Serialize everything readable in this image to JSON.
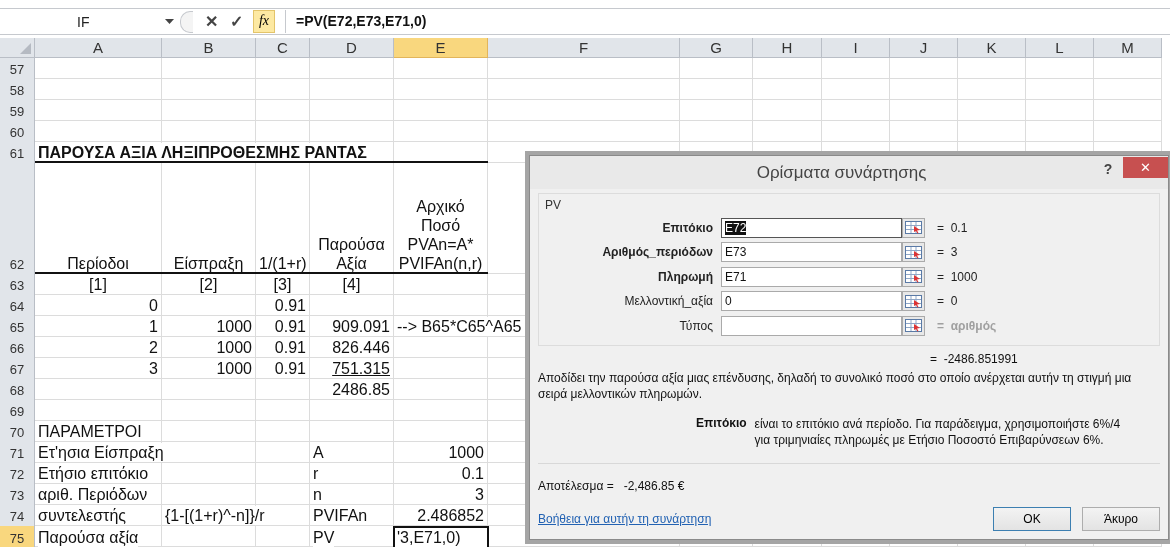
{
  "formula_bar": {
    "name_box": "IF",
    "cancel": "✕",
    "enter": "✓",
    "fx": "fx",
    "formula": "=PV(E72,E73,E71,0)"
  },
  "columns": [
    {
      "label": "A",
      "selected": false
    },
    {
      "label": "B",
      "selected": false
    },
    {
      "label": "C",
      "selected": false
    },
    {
      "label": "D",
      "selected": false
    },
    {
      "label": "E",
      "selected": true
    },
    {
      "label": "F",
      "selected": false
    },
    {
      "label": "G",
      "selected": false
    },
    {
      "label": "H",
      "selected": false
    },
    {
      "label": "I",
      "selected": false
    },
    {
      "label": "J",
      "selected": false
    },
    {
      "label": "K",
      "selected": false
    },
    {
      "label": "L",
      "selected": false
    },
    {
      "label": "M",
      "selected": false
    }
  ],
  "rows": [
    {
      "number": "57",
      "selected": false,
      "rule_below": false,
      "cells": []
    },
    {
      "number": "58",
      "selected": false,
      "rule_below": false,
      "cells": []
    },
    {
      "number": "59",
      "selected": false,
      "rule_below": false,
      "cells": []
    },
    {
      "number": "60",
      "selected": false,
      "rule_below": false,
      "cells": []
    },
    {
      "number": "61",
      "selected": false,
      "rule_below": true,
      "cells": [
        {
          "kind": "text",
          "text": "ΠΑΡΟΥΣΑ ΑΞΙΑ ΛΗΞΙΠΡΟΘΕΣΜΗΣ ΡΑΝΤΑΣ",
          "bold": true
        }
      ]
    },
    {
      "number": "62",
      "selected": false,
      "rule_below": true,
      "cells": [
        {
          "kind": "heading",
          "text": "Περίοδοι"
        },
        {
          "kind": "heading",
          "text": "Είσπραξη"
        },
        {
          "kind": "heading",
          "text": "1/(1+r)"
        },
        {
          "kind": "heading",
          "text": "Παρούσα\nΑξία"
        },
        {
          "kind": "heading",
          "text": "Αρχικό\nΠοσό\nPVAn=A*\nPVIFAn(n,r)"
        }
      ]
    },
    {
      "number": "63",
      "selected": false,
      "rule_below": false,
      "cells": [
        {
          "kind": "heading",
          "text": "[1]"
        },
        {
          "kind": "heading",
          "text": "[2]"
        },
        {
          "kind": "heading",
          "text": "[3]"
        },
        {
          "kind": "heading",
          "text": "[4]"
        }
      ]
    },
    {
      "number": "64",
      "selected": false,
      "rule_below": false,
      "cells": [
        {
          "kind": "number",
          "text": "0"
        },
        {
          "kind": "empty"
        },
        {
          "kind": "number",
          "text": "0.91"
        }
      ]
    },
    {
      "number": "65",
      "selected": false,
      "rule_below": false,
      "cells": [
        {
          "kind": "number",
          "text": "1"
        },
        {
          "kind": "number",
          "text": "1000"
        },
        {
          "kind": "number",
          "text": "0.91"
        },
        {
          "kind": "number",
          "text": "909.091"
        },
        {
          "kind": "text",
          "text": "--> B65*C65^A65"
        }
      ]
    },
    {
      "number": "66",
      "selected": false,
      "rule_below": false,
      "cells": [
        {
          "kind": "number",
          "text": "2"
        },
        {
          "kind": "number",
          "text": "1000"
        },
        {
          "kind": "number",
          "text": "0.91"
        },
        {
          "kind": "number",
          "text": "826.446"
        }
      ]
    },
    {
      "number": "67",
      "selected": false,
      "rule_below": false,
      "cells": [
        {
          "kind": "number",
          "text": "3"
        },
        {
          "kind": "number",
          "text": "1000"
        },
        {
          "kind": "number",
          "text": "0.91"
        },
        {
          "kind": "number",
          "text": "751.315",
          "underlined": true
        }
      ]
    },
    {
      "number": "68",
      "selected": false,
      "rule_below": false,
      "cells": [
        {
          "kind": "empty"
        },
        {
          "kind": "empty"
        },
        {
          "kind": "empty"
        },
        {
          "kind": "number",
          "text": "2486.85"
        }
      ]
    },
    {
      "number": "69",
      "selected": false,
      "rule_below": false,
      "cells": []
    },
    {
      "number": "70",
      "selected": false,
      "rule_below": false,
      "cells": [
        {
          "kind": "text",
          "text": "ΠΑΡΑΜΕΤΡΟΙ"
        }
      ]
    },
    {
      "number": "71",
      "selected": false,
      "rule_below": false,
      "cells": [
        {
          "kind": "text",
          "text": "Ετ'ησια Είσπραξη"
        },
        {
          "kind": "empty"
        },
        {
          "kind": "empty"
        },
        {
          "kind": "text",
          "text": "A"
        },
        {
          "kind": "number",
          "text": "1000"
        }
      ]
    },
    {
      "number": "72",
      "selected": false,
      "rule_below": false,
      "cells": [
        {
          "kind": "text",
          "text": "Ετήσιο επιτόκιο"
        },
        {
          "kind": "empty"
        },
        {
          "kind": "empty"
        },
        {
          "kind": "text",
          "text": "r"
        },
        {
          "kind": "number",
          "text": "0.1"
        }
      ]
    },
    {
      "number": "73",
      "selected": false,
      "rule_below": false,
      "cells": [
        {
          "kind": "text",
          "text": "αριθ. Περιόδων"
        },
        {
          "kind": "empty"
        },
        {
          "kind": "empty"
        },
        {
          "kind": "text",
          "text": "n"
        },
        {
          "kind": "number",
          "text": "3"
        }
      ]
    },
    {
      "number": "74",
      "selected": false,
      "rule_below": false,
      "cells": [
        {
          "kind": "text",
          "text": "συντελεστής"
        },
        {
          "kind": "text",
          "text": "{1-[(1+r)^-n]}/r"
        },
        {
          "kind": "empty"
        },
        {
          "kind": "text",
          "text": "PVIFAn"
        },
        {
          "kind": "number",
          "text": "2.486852"
        }
      ]
    },
    {
      "number": "75",
      "selected": true,
      "rule_below": false,
      "cells": [
        {
          "kind": "text",
          "text": "Παρούσα αξία"
        },
        {
          "kind": "empty"
        },
        {
          "kind": "empty"
        },
        {
          "kind": "text",
          "text": "PV"
        },
        {
          "kind": "text",
          "text": "'3,E71,0)",
          "active": true
        }
      ]
    }
  ],
  "dialog": {
    "title": "Ορίσματα συνάρτησης",
    "help": "?",
    "close": "✕",
    "function_name": "PV",
    "arguments": [
      {
        "label": "Επιτόκιο",
        "required": true,
        "value": "E72",
        "focused": true,
        "result": "=  0.1",
        "result_dim": false
      },
      {
        "label": "Αριθμός_περιόδων",
        "required": true,
        "value": "E73",
        "focused": false,
        "result": "=  3",
        "result_dim": false
      },
      {
        "label": "Πληρωμή",
        "required": true,
        "value": "E71",
        "focused": false,
        "result": "=  1000",
        "result_dim": false
      },
      {
        "label": "Μελλοντική_αξία",
        "required": false,
        "value": "0",
        "focused": false,
        "result": "=  0",
        "result_dim": false
      },
      {
        "label": "Τύπος",
        "required": false,
        "focused": false,
        "result": "=  αριθμός",
        "result_dim": true
      }
    ],
    "formula_result": "=  -2486.851991",
    "description": "Αποδίδει την παρούσα αξία μιας επένδυσης, δηλαδή το συνολικό ποσό στο οποίο ανέρχεται αυτήν τη στιγμή μια σειρά μελλοντικών πληρωμών.",
    "argument_help": {
      "label": "Επιτόκιο",
      "text": "είναι το επιτόκιο ανά περίοδο. Για παράδειγμα, χρησιμοποιήστε 6%/4 για τριμηνιαίες πληρωμές με Ετήσιο Ποσοστό Επιβαρύνσεων 6%."
    },
    "result_label": "Αποτέλεσμα =",
    "result_value": "-2,486.85 €",
    "help_link": "Βοήθεια για αυτήν τη συνάρτηση",
    "buttons": [
      {
        "label": "OK",
        "default": true
      },
      {
        "label": "Άκυρο",
        "default": false
      }
    ]
  }
}
